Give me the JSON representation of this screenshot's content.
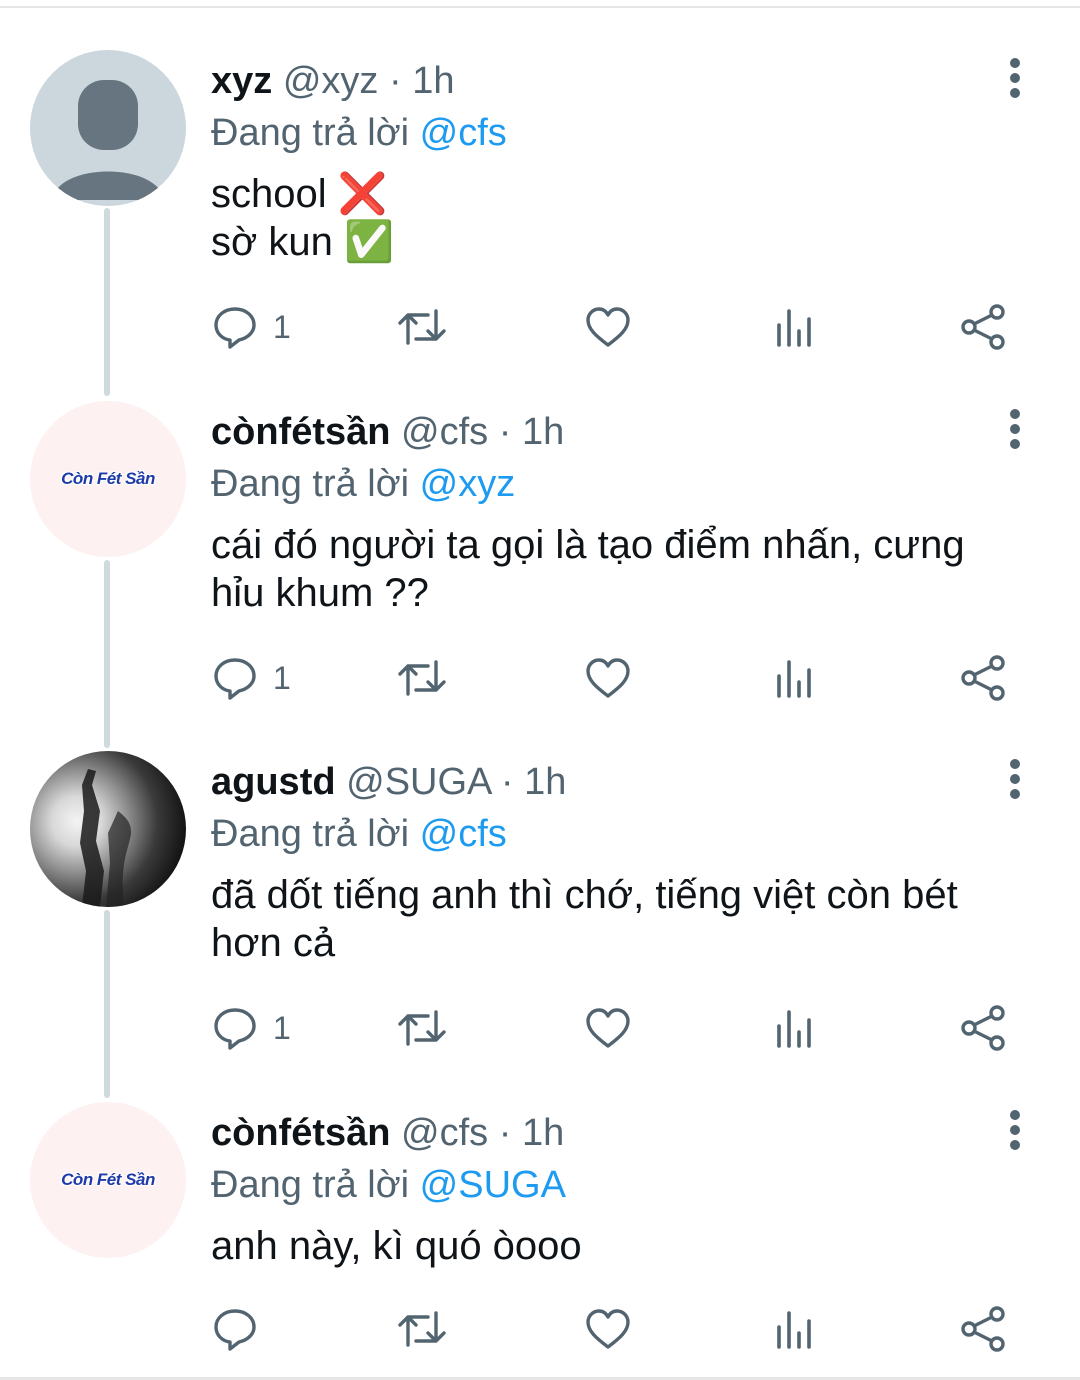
{
  "colors": {
    "accent": "#1d9bf0",
    "muted": "#536471",
    "text": "#0f1419",
    "thread_line": "#cfd9de"
  },
  "tweets": [
    {
      "avatar_type": "default-avatar",
      "name": "xyz",
      "handle": "@xyz",
      "separator": "·",
      "time": "1h",
      "replying_prefix": "Đang trả lời",
      "replying_to": "@cfs",
      "lines": [
        "school ❌",
        "sờ kun ✅"
      ],
      "reply_count": "1"
    },
    {
      "avatar_type": "brand-avatar",
      "avatar_text": "Còn Fét Sần",
      "name": "cònfétsần",
      "handle": "@cfs",
      "separator": "·",
      "time": "1h",
      "replying_prefix": "Đang trả lời",
      "replying_to": "@xyz",
      "lines": [
        "cái đó người ta gọi là tạo điểm nhấn, cưng",
        "hỉu khum ??"
      ],
      "reply_count": "1"
    },
    {
      "avatar_type": "photo-avatar",
      "name": "agustd",
      "handle": "@SUGA",
      "separator": "·",
      "time": "1h",
      "replying_prefix": "Đang trả lời",
      "replying_to": "@cfs",
      "lines": [
        "đã dốt tiếng anh thì chớ, tiếng việt còn bét",
        "hơn cả"
      ],
      "reply_count": "1"
    },
    {
      "avatar_type": "brand-avatar",
      "avatar_text": "Còn Fét Sần",
      "name": "cònfétsần",
      "handle": "@cfs",
      "separator": "·",
      "time": "1h",
      "replying_prefix": "Đang trả lời",
      "replying_to": "@SUGA",
      "lines": [
        "anh này, kì quó òooo"
      ],
      "reply_count": ""
    }
  ],
  "action_icons": [
    "reply-icon",
    "retweet-icon",
    "like-icon",
    "analytics-icon",
    "share-icon"
  ]
}
